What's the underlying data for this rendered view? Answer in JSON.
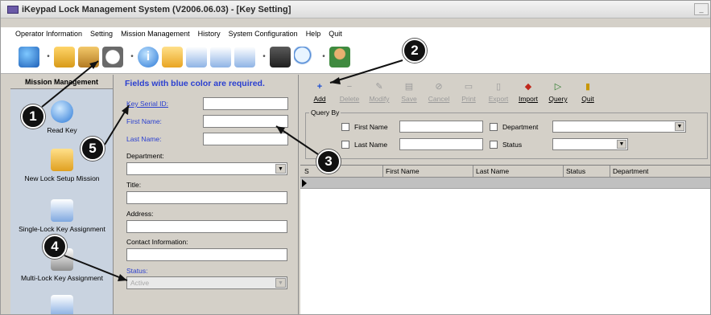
{
  "window": {
    "title": "iKeypad Lock Management System   (V2006.06.03) - [Key Setting]"
  },
  "menu": [
    "Operator Information",
    "Setting",
    "Mission Management",
    "History",
    "System Configuration",
    "Help",
    "Quit"
  ],
  "toolbar_icons": [
    "globe-icon",
    "lock-icon",
    "keys-icon",
    "clock-icon",
    "info-icon",
    "folder-icon",
    "document-icon",
    "import-icon",
    "export-icon",
    "calculator-icon",
    "magnifier-icon",
    "user-icon"
  ],
  "sidebar": {
    "header": "Mission Management",
    "items": [
      {
        "label": "Read Key",
        "icon": "info-icon"
      },
      {
        "label": "New Lock Setup Mission",
        "icon": "folder-arrow-icon"
      },
      {
        "label": "Single-Lock Key Assignment",
        "icon": "document-icon"
      },
      {
        "label": "Multi-Lock Key Assignment",
        "icon": "documents-icon"
      }
    ]
  },
  "form": {
    "hint": "Fields with blue color are required.",
    "key_serial_id": "Key Serial ID:",
    "first_name": "First Name:",
    "last_name": "Last Name:",
    "department": "Department:",
    "title": "Title:",
    "address": "Address:",
    "contact": "Contact Information:",
    "status": "Status:",
    "status_value": "Active"
  },
  "actions": [
    {
      "label": "Add",
      "icon": "add-icon",
      "enabled": true
    },
    {
      "label": "Delete",
      "icon": "delete-icon",
      "enabled": false
    },
    {
      "label": "Modify",
      "icon": "modify-icon",
      "enabled": false
    },
    {
      "label": "Save",
      "icon": "save-icon",
      "enabled": false
    },
    {
      "label": "Cancel",
      "icon": "cancel-icon",
      "enabled": false
    },
    {
      "label": "Print",
      "icon": "print-icon",
      "enabled": false
    },
    {
      "label": "Export",
      "icon": "export-icon",
      "enabled": false
    },
    {
      "label": "Import",
      "icon": "import-icon",
      "enabled": true
    },
    {
      "label": "Query",
      "icon": "query-icon",
      "enabled": true
    },
    {
      "label": "Quit",
      "icon": "quit-icon",
      "enabled": true
    }
  ],
  "query": {
    "title": "Query By",
    "first_name": "First Name",
    "last_name": "Last Name",
    "department": "Department",
    "status": "Status"
  },
  "grid": {
    "columns": [
      "S",
      "First Name",
      "Last Name",
      "Status",
      "Department"
    ]
  },
  "callouts": [
    "1",
    "2",
    "3",
    "4",
    "5"
  ],
  "colors": {
    "required_blue": "#2a3fd0",
    "sidebar_bg": "#c9d3e0",
    "panel_bg": "#d4d0c8"
  }
}
